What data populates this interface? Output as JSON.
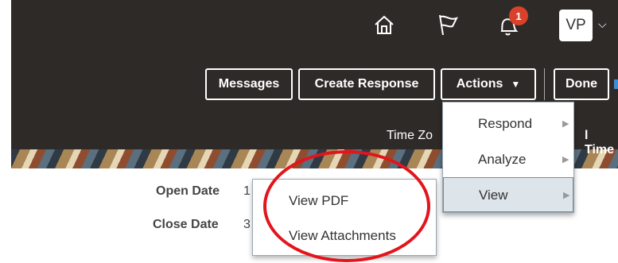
{
  "header": {
    "icons": [
      "home-icon",
      "flag-icon",
      "bell-icon"
    ],
    "notification_count": "1",
    "user_initials": "VP",
    "user_menu_chevron": "⌵"
  },
  "toolbar": {
    "messages_label": "Messages",
    "create_response_label": "Create Response",
    "actions_label": "Actions",
    "actions_caret": "▼",
    "done_label": "Done"
  },
  "timezone": {
    "label_partial": "Time Zo",
    "value_partial": "l Time"
  },
  "actions_menu": {
    "items": [
      {
        "label": "Respond",
        "arrow": "▶"
      },
      {
        "label": "Analyze",
        "arrow": "▶"
      },
      {
        "label": "View",
        "arrow": "▶"
      }
    ]
  },
  "view_submenu": {
    "items": [
      "View PDF",
      "View Attachments"
    ]
  },
  "fields": {
    "open_date_label": "Open Date",
    "open_date_value": "1",
    "close_date_label": "Close Date",
    "close_date_value": "3"
  },
  "colors": {
    "header_bg": "#2e2a28",
    "annotation_red": "#e3141c",
    "badge_red": "#d9412a"
  }
}
